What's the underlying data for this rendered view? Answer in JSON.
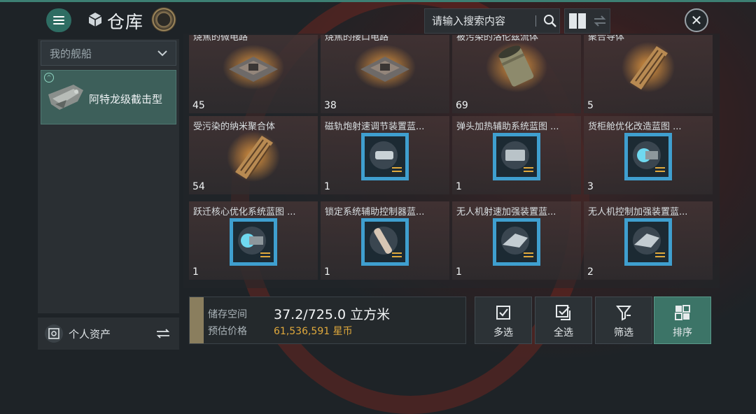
{
  "header": {
    "title": "仓库",
    "search_placeholder": "请输入搜索内容",
    "icons": [
      "menu-icon",
      "cube-icon",
      "coin-icon",
      "search-icon",
      "grid-view-icon",
      "swap-arrows-icon",
      "close-icon"
    ]
  },
  "sidebar": {
    "dropdown_label": "我的舰船",
    "ship_name": "阿特龙级截击型",
    "assets_label": "个人资产"
  },
  "items": [
    {
      "name": "烧焦的微电路",
      "count": "45",
      "icon": "chip-icon"
    },
    {
      "name": "烧焦的接口电路",
      "count": "38",
      "icon": "chip-icon"
    },
    {
      "name": "被污染的洛伦兹流体",
      "count": "69",
      "icon": "canister-icon"
    },
    {
      "name": "聚合导体",
      "count": "5",
      "icon": "conductor-icon"
    },
    {
      "name": "受污染的纳米聚合体",
      "count": "54",
      "icon": "conductor-icon"
    },
    {
      "name": "磁轨炮射速调节装置蓝...",
      "count": "1",
      "icon": "blueprint-icon"
    },
    {
      "name": "弹头加热辅助系统蓝图 ...",
      "count": "1",
      "icon": "blueprint-icon"
    },
    {
      "name": "货柜舱优化改造蓝图 ...",
      "count": "3",
      "icon": "blueprint-icon"
    },
    {
      "name": "跃迁核心优化系统蓝图 ...",
      "count": "1",
      "icon": "blueprint-icon"
    },
    {
      "name": "锁定系统辅助控制器蓝...",
      "count": "1",
      "icon": "blueprint-icon"
    },
    {
      "name": "无人机射速加强装置蓝...",
      "count": "1",
      "icon": "blueprint-icon"
    },
    {
      "name": "无人机控制加强装置蓝...",
      "count": "2",
      "icon": "blueprint-icon"
    }
  ],
  "footer": {
    "storage_label": "储存空间",
    "storage_value": "37.2/725.0 立方米",
    "price_label": "预估价格",
    "price_value": "61,536,591 星币",
    "actions": [
      {
        "label": "多选",
        "icon": "checkbox-icon"
      },
      {
        "label": "全选",
        "icon": "check-all-icon"
      },
      {
        "label": "筛选",
        "icon": "filter-icon"
      },
      {
        "label": "排序",
        "icon": "sort-icon"
      }
    ]
  },
  "colors": {
    "accent": "#3c7467",
    "price": "#e0a93c",
    "background": "#1e2327"
  }
}
